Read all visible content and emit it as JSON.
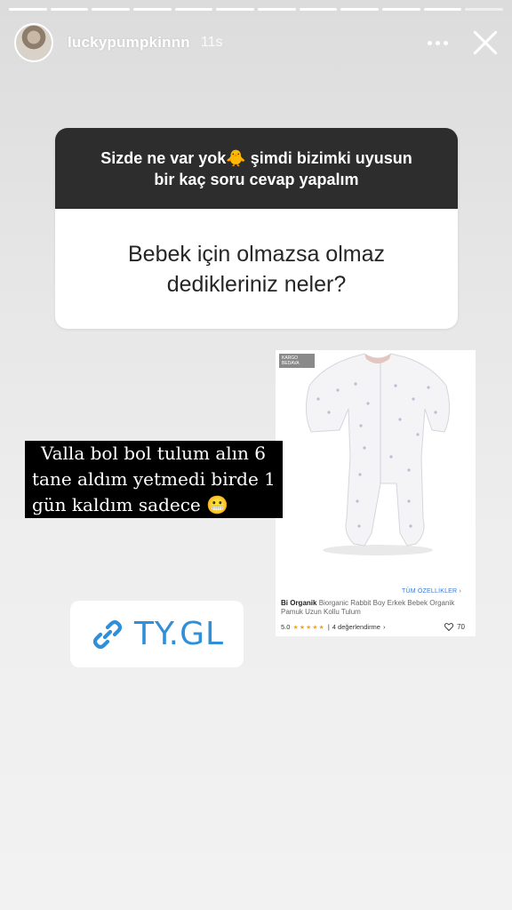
{
  "story": {
    "username": "luckypumpkinnn",
    "time": "11s",
    "segments": 12,
    "current_segment": 12
  },
  "question_sticker": {
    "prompt_line1": "Sizde ne var yok🐥 şimdi bizimki uyusun",
    "prompt_line2": "bir kaç soru cevap yapalım",
    "answer_line1": "Bebek için olmazsa olmaz",
    "answer_line2": "dedikleriniz neler?"
  },
  "caption": {
    "line1": "Valla bol bol tulum alın 6",
    "line2": "tane aldım yetmedi birde 1",
    "line3": "gün kaldım sadece 😬"
  },
  "product": {
    "badge": "KARGO BEDAVA",
    "features_link": "TÜM ÖZELLİKLER",
    "brand": "Bi Organik",
    "name": "Biorganic Rabbit Boy Erkek Bebek Organik Pamuk Uzun Kollu Tulum",
    "rating": "5.0",
    "reviews": "4 değerlendirme",
    "likes": "70"
  },
  "link_sticker": {
    "text": "TY.GL",
    "icon": "link-icon"
  },
  "colors": {
    "prompt_bg": "#2d2d2d",
    "link_blue": "#2f8fd8",
    "caption_bg": "#000000"
  }
}
